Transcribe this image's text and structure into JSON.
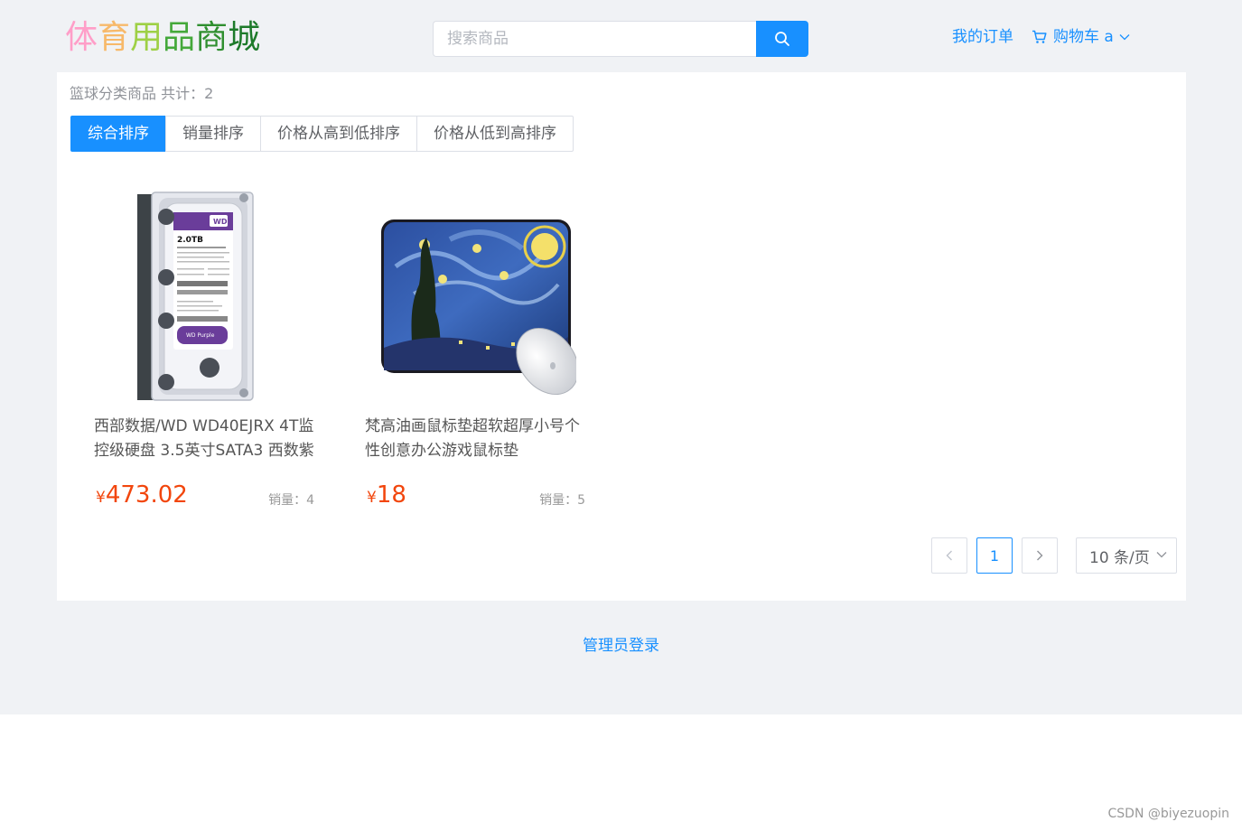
{
  "header": {
    "logo_chars": [
      {
        "ch": "体",
        "color": "#ff9ec8"
      },
      {
        "ch": "育",
        "color": "#f7b96a"
      },
      {
        "ch": "用",
        "color": "#9ed045"
      },
      {
        "ch": "品",
        "color": "#44a83a"
      },
      {
        "ch": "商",
        "color": "#2f8f2f"
      },
      {
        "ch": "城",
        "color": "#1d7a2a"
      }
    ],
    "search_placeholder": "搜索商品",
    "my_orders": "我的订单",
    "cart_label": "购物车 a"
  },
  "category": {
    "count_text": "篮球分类商品 共计：2"
  },
  "sort_options": [
    {
      "label": "综合排序",
      "active": true
    },
    {
      "label": "销量排序",
      "active": false
    },
    {
      "label": "价格从高到低排序",
      "active": false
    },
    {
      "label": "价格从低到高排序",
      "active": false
    }
  ],
  "products": [
    {
      "title": "西部数据/WD WD40EJRX 4T监控级硬盘 3.5英寸SATA3 西数紫",
      "currency": "¥",
      "price": "473.02",
      "sales": "销量：4",
      "image_icon": "hard-drive-image",
      "image_text": "2.0TB"
    },
    {
      "title": "梵高油画鼠标垫超软超厚小号个性创意办公游戏鼠标垫",
      "currency": "¥",
      "price": "18",
      "sales": "销量：5",
      "image_icon": "mousepad-image"
    }
  ],
  "pagination": {
    "current_page": "1",
    "page_size": "10 条/页"
  },
  "footer": {
    "admin_login": "管理员登录"
  },
  "watermark": "CSDN @biyezuopin",
  "colors": {
    "primary": "#1890ff",
    "price": "#f2460d",
    "page_bg": "#f0f2f5"
  }
}
